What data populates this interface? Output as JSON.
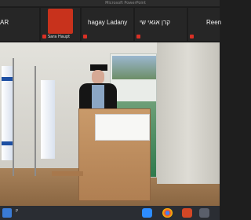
{
  "window": {
    "title": "Microsoft PowerPoint"
  },
  "participants": [
    {
      "display_name": "AR",
      "label": ""
    },
    {
      "display_name": "",
      "label": "Sara Haupt"
    },
    {
      "display_name": "hagay Ladany",
      "label": ""
    },
    {
      "display_name": "קרן אגאי שי",
      "label": ""
    },
    {
      "display_name": "Reen",
      "label": ""
    }
  ],
  "taskbar": {
    "search_hint": "P"
  },
  "colors": {
    "muted_mic": "#d93025",
    "zoom_blue": "#2d8cff"
  }
}
